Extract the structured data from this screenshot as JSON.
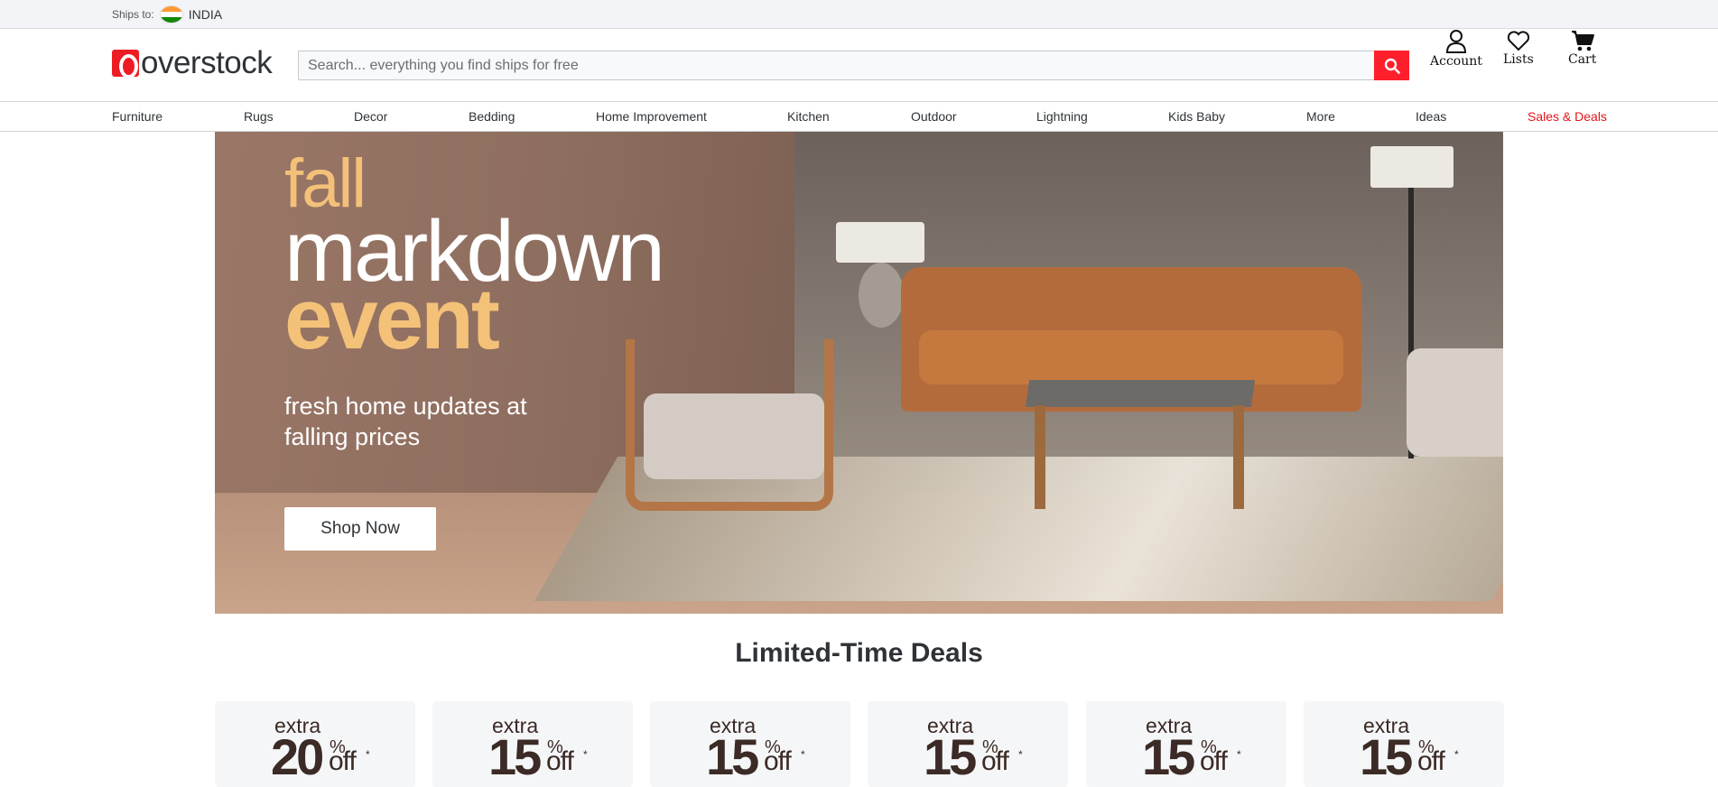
{
  "topbar": {
    "ships_label": "Ships to:",
    "country": "INDIA"
  },
  "header": {
    "logo": "overstock",
    "search_placeholder": "Search... everything you find ships for free",
    "account_label": "Account",
    "lists_label": "Lists",
    "cart_label": "Cart"
  },
  "nav": {
    "items": [
      "Furniture",
      "Rugs",
      "Decor",
      "Bedding",
      "Home Improvement",
      "Kitchen",
      "Outdoor",
      "Lightning",
      "Kids Baby",
      "More",
      "Ideas",
      "Sales & Deals"
    ]
  },
  "hero": {
    "line1": "fall",
    "line2": "markdown",
    "line3": "event",
    "subtitle": "fresh home updates at falling prices",
    "cta": "Shop Now"
  },
  "deals": {
    "title": "Limited-Time Deals",
    "cards": [
      {
        "extra": "extra",
        "percent": "20",
        "symbol": "%",
        "off": "off",
        "asterisk": "*"
      },
      {
        "extra": "extra",
        "percent": "15",
        "symbol": "%",
        "off": "off",
        "asterisk": "*"
      },
      {
        "extra": "extra",
        "percent": "15",
        "symbol": "%",
        "off": "off",
        "asterisk": "*"
      },
      {
        "extra": "extra",
        "percent": "15",
        "symbol": "%",
        "off": "off",
        "asterisk": "*"
      },
      {
        "extra": "extra",
        "percent": "15",
        "symbol": "%",
        "off": "off",
        "asterisk": "*"
      },
      {
        "extra": "extra",
        "percent": "15",
        "symbol": "%",
        "off": "off",
        "asterisk": "*"
      }
    ]
  },
  "colors": {
    "brand_red": "#ff1f2c",
    "deal_text": "#3b2a25",
    "hero_accent": "#f4c179"
  }
}
